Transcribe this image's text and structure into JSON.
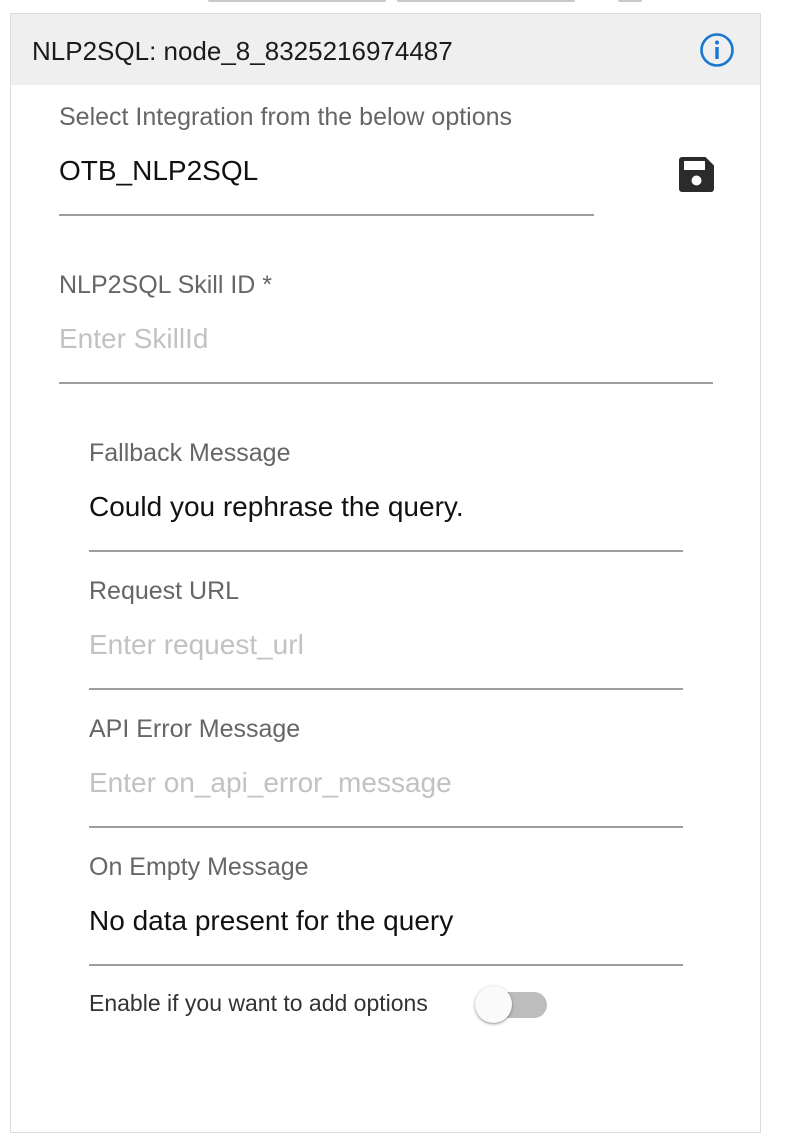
{
  "panel": {
    "title": "NLP2SQL: node_8_8325216974487",
    "info_icon": "info-circle-icon",
    "accent_color": "#1976d2"
  },
  "integration": {
    "label": "Select Integration from the below options",
    "value": "OTB_NLP2SQL",
    "save_icon": "floppy-disk-save-icon"
  },
  "skill_id": {
    "label": "NLP2SQL Skill ID *",
    "value": "",
    "placeholder": "Enter SkillId"
  },
  "fallback_message": {
    "label": "Fallback Message",
    "value": "Could you rephrase the query.",
    "placeholder": ""
  },
  "request_url": {
    "label": "Request URL",
    "value": "",
    "placeholder": "Enter request_url"
  },
  "api_error_message": {
    "label": "API Error Message",
    "value": "",
    "placeholder": "Enter on_api_error_message"
  },
  "on_empty_message": {
    "label": "On Empty Message",
    "value": "No data present for the query",
    "placeholder": ""
  },
  "options_toggle": {
    "label": "Enable if you want to add options",
    "enabled": false
  }
}
